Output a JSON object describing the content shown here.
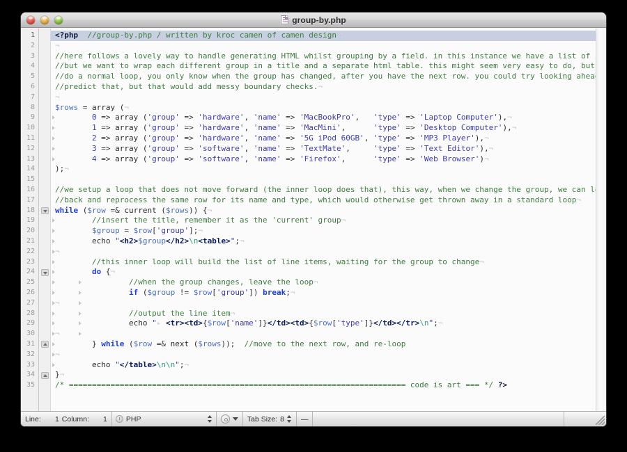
{
  "window": {
    "title": "group-by.php",
    "doc_icon": "php-document-icon",
    "controls": {
      "close": "Close",
      "minimize": "Minimize",
      "zoom": "Zoom"
    }
  },
  "editor": {
    "current_line": 1,
    "total_lines": 35,
    "eol_marker": "¬",
    "tab_marker": "▸",
    "colors": {
      "comment": "#3f7d3f",
      "keyword": "#1c3fd6",
      "string": "#3b3bb5",
      "variable": "#4a6fc4",
      "html_tag": "#0b1b66",
      "escape": "#2fa07a",
      "current_line_bg": "#c8cfe0",
      "gutter_bg": "#f0f0f0",
      "code_bg": "#fbfbfb"
    },
    "lines": [
      {
        "n": 1,
        "fold": null,
        "tabs": 0,
        "eol": true,
        "current": true,
        "tokens": [
          [
            "php",
            "<?php"
          ],
          [
            "plain",
            "  "
          ],
          [
            "com",
            "//group-by.php / written by kroc camen of camen design"
          ]
        ]
      },
      {
        "n": 2,
        "fold": null,
        "tabs": 0,
        "eol": true,
        "tokens": []
      },
      {
        "n": 3,
        "fold": null,
        "tabs": 0,
        "eol": true,
        "tokens": [
          [
            "com",
            "//here follows a lovely way to handle generating HTML whilst grouping by a field. in this instance we have a list of items,"
          ]
        ]
      },
      {
        "n": 4,
        "fold": null,
        "tabs": 0,
        "eol": true,
        "tokens": [
          [
            "com",
            "//but we want to wrap each different group in a title and a separate html table. this might seem very easy to do, but if you"
          ]
        ]
      },
      {
        "n": 5,
        "fold": null,
        "tabs": 0,
        "eol": true,
        "tokens": [
          [
            "com",
            "//do a normal loop, you only know when the group has changed, after you have the next row. you could try looking ahead to"
          ]
        ]
      },
      {
        "n": 6,
        "fold": null,
        "tabs": 0,
        "eol": true,
        "tokens": [
          [
            "com",
            "//predict that, but that would add messy boundary checks."
          ]
        ]
      },
      {
        "n": 7,
        "fold": null,
        "tabs": 0,
        "eol": true,
        "tokens": []
      },
      {
        "n": 8,
        "fold": null,
        "tabs": 0,
        "eol": true,
        "tokens": [
          [
            "var",
            "$rows"
          ],
          [
            "op",
            " = "
          ],
          [
            "plain",
            "array ("
          ]
        ]
      },
      {
        "n": 9,
        "fold": null,
        "tabs": 1,
        "eol": true,
        "tokens": [
          [
            "plain",
            "        "
          ],
          [
            "num",
            "0"
          ],
          [
            "op",
            " => "
          ],
          [
            "plain",
            "array ("
          ],
          [
            "str",
            "'group'"
          ],
          [
            "op",
            " => "
          ],
          [
            "str",
            "'hardware'"
          ],
          [
            "plain",
            ", "
          ],
          [
            "str",
            "'name'"
          ],
          [
            "op",
            " => "
          ],
          [
            "str",
            "'MacBookPro'"
          ],
          [
            "plain",
            ",   "
          ],
          [
            "str",
            "'type'"
          ],
          [
            "op",
            " => "
          ],
          [
            "str",
            "'Laptop Computer'"
          ],
          [
            "plain",
            "),"
          ]
        ]
      },
      {
        "n": 10,
        "fold": null,
        "tabs": 1,
        "eol": true,
        "tokens": [
          [
            "plain",
            "        "
          ],
          [
            "num",
            "1"
          ],
          [
            "op",
            " => "
          ],
          [
            "plain",
            "array ("
          ],
          [
            "str",
            "'group'"
          ],
          [
            "op",
            " => "
          ],
          [
            "str",
            "'hardware'"
          ],
          [
            "plain",
            ", "
          ],
          [
            "str",
            "'name'"
          ],
          [
            "op",
            " => "
          ],
          [
            "str",
            "'MacMini'"
          ],
          [
            "plain",
            ",      "
          ],
          [
            "str",
            "'type'"
          ],
          [
            "op",
            " => "
          ],
          [
            "str",
            "'Desktop Computer'"
          ],
          [
            "plain",
            "),"
          ]
        ]
      },
      {
        "n": 11,
        "fold": null,
        "tabs": 1,
        "eol": true,
        "tokens": [
          [
            "plain",
            "        "
          ],
          [
            "num",
            "2"
          ],
          [
            "op",
            " => "
          ],
          [
            "plain",
            "array ("
          ],
          [
            "str",
            "'group'"
          ],
          [
            "op",
            " => "
          ],
          [
            "str",
            "'hardware'"
          ],
          [
            "plain",
            ", "
          ],
          [
            "str",
            "'name'"
          ],
          [
            "op",
            " => "
          ],
          [
            "str",
            "'5G iPod 60GB'"
          ],
          [
            "plain",
            ", "
          ],
          [
            "str",
            "'type'"
          ],
          [
            "op",
            " => "
          ],
          [
            "str",
            "'MP3 Player'"
          ],
          [
            "plain",
            "),"
          ]
        ]
      },
      {
        "n": 12,
        "fold": null,
        "tabs": 1,
        "eol": true,
        "tokens": [
          [
            "plain",
            "        "
          ],
          [
            "num",
            "3"
          ],
          [
            "op",
            " => "
          ],
          [
            "plain",
            "array ("
          ],
          [
            "str",
            "'group'"
          ],
          [
            "op",
            " => "
          ],
          [
            "str",
            "'software'"
          ],
          [
            "plain",
            ", "
          ],
          [
            "str",
            "'name'"
          ],
          [
            "op",
            " => "
          ],
          [
            "str",
            "'TextMate'"
          ],
          [
            "plain",
            ",     "
          ],
          [
            "str",
            "'type'"
          ],
          [
            "op",
            " => "
          ],
          [
            "str",
            "'Text Editor'"
          ],
          [
            "plain",
            "),"
          ]
        ]
      },
      {
        "n": 13,
        "fold": null,
        "tabs": 1,
        "eol": true,
        "tokens": [
          [
            "plain",
            "        "
          ],
          [
            "num",
            "4"
          ],
          [
            "op",
            " => "
          ],
          [
            "plain",
            "array ("
          ],
          [
            "str",
            "'group'"
          ],
          [
            "op",
            " => "
          ],
          [
            "str",
            "'software'"
          ],
          [
            "plain",
            ", "
          ],
          [
            "str",
            "'name'"
          ],
          [
            "op",
            " => "
          ],
          [
            "str",
            "'Firefox'"
          ],
          [
            "plain",
            ",      "
          ],
          [
            "str",
            "'type'"
          ],
          [
            "op",
            " => "
          ],
          [
            "str",
            "'Web Browser'"
          ],
          [
            "plain",
            ")"
          ]
        ]
      },
      {
        "n": 14,
        "fold": null,
        "tabs": 0,
        "eol": true,
        "tokens": [
          [
            "plain",
            ");"
          ]
        ]
      },
      {
        "n": 15,
        "fold": null,
        "tabs": 0,
        "eol": false,
        "tokens": []
      },
      {
        "n": 16,
        "fold": null,
        "tabs": 0,
        "eol": true,
        "tokens": [
          [
            "com",
            "//we setup a loop that does not move forward (the inner loop does that), this way, when we change the group, we can loop"
          ]
        ]
      },
      {
        "n": 17,
        "fold": null,
        "tabs": 0,
        "eol": true,
        "tokens": [
          [
            "com",
            "//back and reprocess the same row for its name and type, which would otherwise get thrown away in a standard loop"
          ]
        ]
      },
      {
        "n": 18,
        "fold": "down",
        "tabs": 0,
        "eol": true,
        "tokens": [
          [
            "kw",
            "while"
          ],
          [
            "plain",
            " ("
          ],
          [
            "var",
            "$row"
          ],
          [
            "op",
            " =& "
          ],
          [
            "plain",
            "current ("
          ],
          [
            "var",
            "$rows"
          ],
          [
            "plain",
            ")) {"
          ]
        ]
      },
      {
        "n": 19,
        "fold": null,
        "tabs": 1,
        "eol": true,
        "tokens": [
          [
            "plain",
            "        "
          ],
          [
            "com",
            "//insert the title, remember it as the 'current' group"
          ]
        ]
      },
      {
        "n": 20,
        "fold": null,
        "tabs": 1,
        "eol": true,
        "tokens": [
          [
            "plain",
            "        "
          ],
          [
            "var",
            "$group"
          ],
          [
            "op",
            " = "
          ],
          [
            "var",
            "$row"
          ],
          [
            "plain",
            "["
          ],
          [
            "str",
            "'group'"
          ],
          [
            "plain",
            "];"
          ]
        ]
      },
      {
        "n": 21,
        "fold": null,
        "tabs": 1,
        "eol": true,
        "tokens": [
          [
            "plain",
            "        echo "
          ],
          [
            "str",
            "\""
          ],
          [
            "tag",
            "<h2>"
          ],
          [
            "var",
            "$group"
          ],
          [
            "tag",
            "</h2>"
          ],
          [
            "esc",
            "\\n"
          ],
          [
            "tag",
            "<table>"
          ],
          [
            "str",
            "\""
          ],
          [
            "plain",
            ";"
          ]
        ]
      },
      {
        "n": 22,
        "fold": null,
        "tabs": 1,
        "eol": true,
        "tokens": []
      },
      {
        "n": 23,
        "fold": null,
        "tabs": 1,
        "eol": true,
        "tokens": [
          [
            "plain",
            "        "
          ],
          [
            "com",
            "//this inner loop will build the list of line items, waiting for the group to change"
          ]
        ]
      },
      {
        "n": 24,
        "fold": "down",
        "tabs": 1,
        "eol": true,
        "tokens": [
          [
            "plain",
            "        "
          ],
          [
            "kw",
            "do"
          ],
          [
            "plain",
            " {"
          ]
        ]
      },
      {
        "n": 25,
        "fold": null,
        "tabs": 2,
        "eol": true,
        "tokens": [
          [
            "plain",
            "                "
          ],
          [
            "com",
            "//when the group changes, leave the loop"
          ]
        ]
      },
      {
        "n": 26,
        "fold": null,
        "tabs": 2,
        "eol": true,
        "tokens": [
          [
            "plain",
            "                "
          ],
          [
            "kw",
            "if"
          ],
          [
            "plain",
            " ("
          ],
          [
            "var",
            "$group"
          ],
          [
            "op",
            " != "
          ],
          [
            "var",
            "$row"
          ],
          [
            "plain",
            "["
          ],
          [
            "str",
            "'group'"
          ],
          [
            "plain",
            "]) "
          ],
          [
            "kw",
            "break"
          ],
          [
            "plain",
            ";"
          ]
        ]
      },
      {
        "n": 27,
        "fold": null,
        "tabs": 2,
        "eol": true,
        "tokens": []
      },
      {
        "n": 28,
        "fold": null,
        "tabs": 2,
        "eol": true,
        "tokens": [
          [
            "plain",
            "                "
          ],
          [
            "com",
            "//output the line item"
          ]
        ]
      },
      {
        "n": 29,
        "fold": null,
        "tabs": 2,
        "eol": true,
        "tokens": [
          [
            "plain",
            "                echo "
          ],
          [
            "str",
            "\""
          ],
          [
            "inv",
            "▸ "
          ],
          [
            "tag",
            "<tr><td>"
          ],
          [
            "plain",
            "{"
          ],
          [
            "var",
            "$row"
          ],
          [
            "plain",
            "["
          ],
          [
            "str",
            "'name'"
          ],
          [
            "plain",
            "]}"
          ],
          [
            "tag",
            "</td><td>"
          ],
          [
            "plain",
            "{"
          ],
          [
            "var",
            "$row"
          ],
          [
            "plain",
            "["
          ],
          [
            "str",
            "'type'"
          ],
          [
            "plain",
            "]}"
          ],
          [
            "tag",
            "</td></tr>"
          ],
          [
            "esc",
            "\\n"
          ],
          [
            "str",
            "\""
          ],
          [
            "plain",
            ";"
          ]
        ]
      },
      {
        "n": 30,
        "fold": null,
        "tabs": 2,
        "eol": true,
        "tokens": []
      },
      {
        "n": 31,
        "fold": "up",
        "tabs": 1,
        "eol": false,
        "tokens": [
          [
            "plain",
            "        } "
          ],
          [
            "kw",
            "while"
          ],
          [
            "plain",
            " ("
          ],
          [
            "var",
            "$row"
          ],
          [
            "op",
            " =& "
          ],
          [
            "plain",
            "next ("
          ],
          [
            "var",
            "$rows"
          ],
          [
            "plain",
            "));  "
          ],
          [
            "com",
            "//move to the next row, and re-loop"
          ]
        ]
      },
      {
        "n": 32,
        "fold": null,
        "tabs": 1,
        "eol": true,
        "tokens": []
      },
      {
        "n": 33,
        "fold": null,
        "tabs": 1,
        "eol": true,
        "tokens": [
          [
            "plain",
            "        echo "
          ],
          [
            "str",
            "\""
          ],
          [
            "tag",
            "</table>"
          ],
          [
            "esc",
            "\\n\\n"
          ],
          [
            "str",
            "\""
          ],
          [
            "plain",
            ";"
          ]
        ]
      },
      {
        "n": 34,
        "fold": "up",
        "tabs": 0,
        "eol": true,
        "tokens": [
          [
            "plain",
            "}"
          ]
        ]
      },
      {
        "n": 35,
        "fold": null,
        "tabs": 0,
        "eol": false,
        "tokens": [
          [
            "com",
            "/* ========================================================================= code is art === */"
          ],
          [
            "plain",
            " "
          ],
          [
            "php",
            "?>"
          ]
        ]
      }
    ]
  },
  "statusbar": {
    "line_label": "Line:",
    "line_value": "1",
    "column_label": "Column:",
    "column_value": "1",
    "language": "PHP",
    "language_icon": "language-bundle-icon",
    "gear_icon": "gear-icon",
    "caret_icon": "chevron-down-icon",
    "tab_size_label": "Tab Size:",
    "tab_size_value": "8",
    "soft_wrap": "—",
    "grip_icon": "resize-grip-icon"
  }
}
